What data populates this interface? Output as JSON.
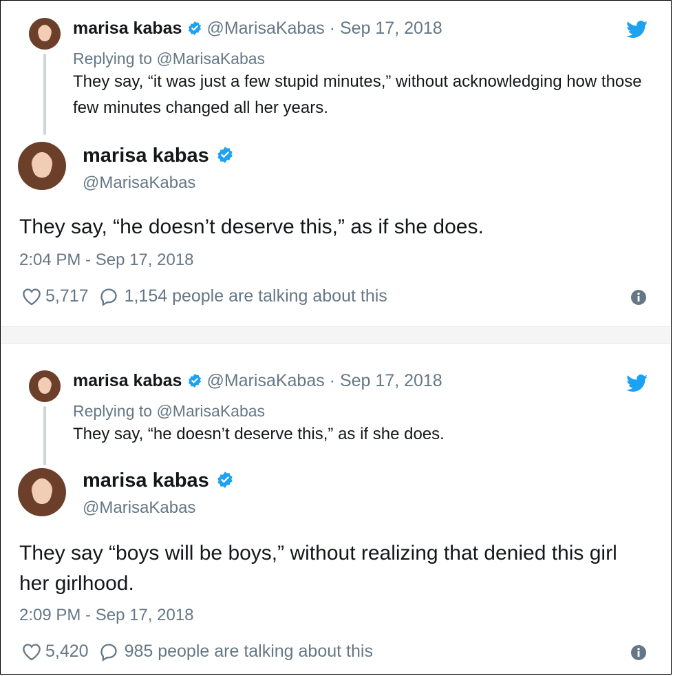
{
  "tweets": [
    {
      "parent": {
        "name": "marisa kabas",
        "handle": "@MarisaKabas",
        "date_sep": " · ",
        "date": "Sep 17, 2018",
        "replying_to": "Replying to @MarisaKabas",
        "text": "They say, “it was just a few stupid minutes,” without acknowledging how those few minutes changed all her years."
      },
      "name": "marisa kabas",
      "handle": "@MarisaKabas",
      "text": "They say, “he doesn’t deserve this,” as if she does.",
      "timestamp": "2:04 PM - Sep 17, 2018",
      "likes": "5,717",
      "talking": "1,154 people are talking about this"
    },
    {
      "parent": {
        "name": "marisa kabas",
        "handle": "@MarisaKabas",
        "date_sep": " · ",
        "date": "Sep 17, 2018",
        "replying_to": "Replying to @MarisaKabas",
        "text": "They say, “he doesn’t deserve this,” as if she does."
      },
      "name": "marisa kabas",
      "handle": "@MarisaKabas",
      "text": "They say “boys will be boys,” without realizing that denied this girl her girlhood.",
      "timestamp": "2:09 PM - Sep 17, 2018",
      "likes": "5,420",
      "talking": "985 people are talking about this"
    }
  ],
  "icons": {
    "verified": "verified-badge-icon",
    "bird": "twitter-bird-icon",
    "heart": "heart-icon",
    "bubble": "reply-bubble-icon",
    "info": "info-icon"
  },
  "colors": {
    "accent": "#1da1f2",
    "muted": "#657786",
    "text": "#14171a"
  }
}
